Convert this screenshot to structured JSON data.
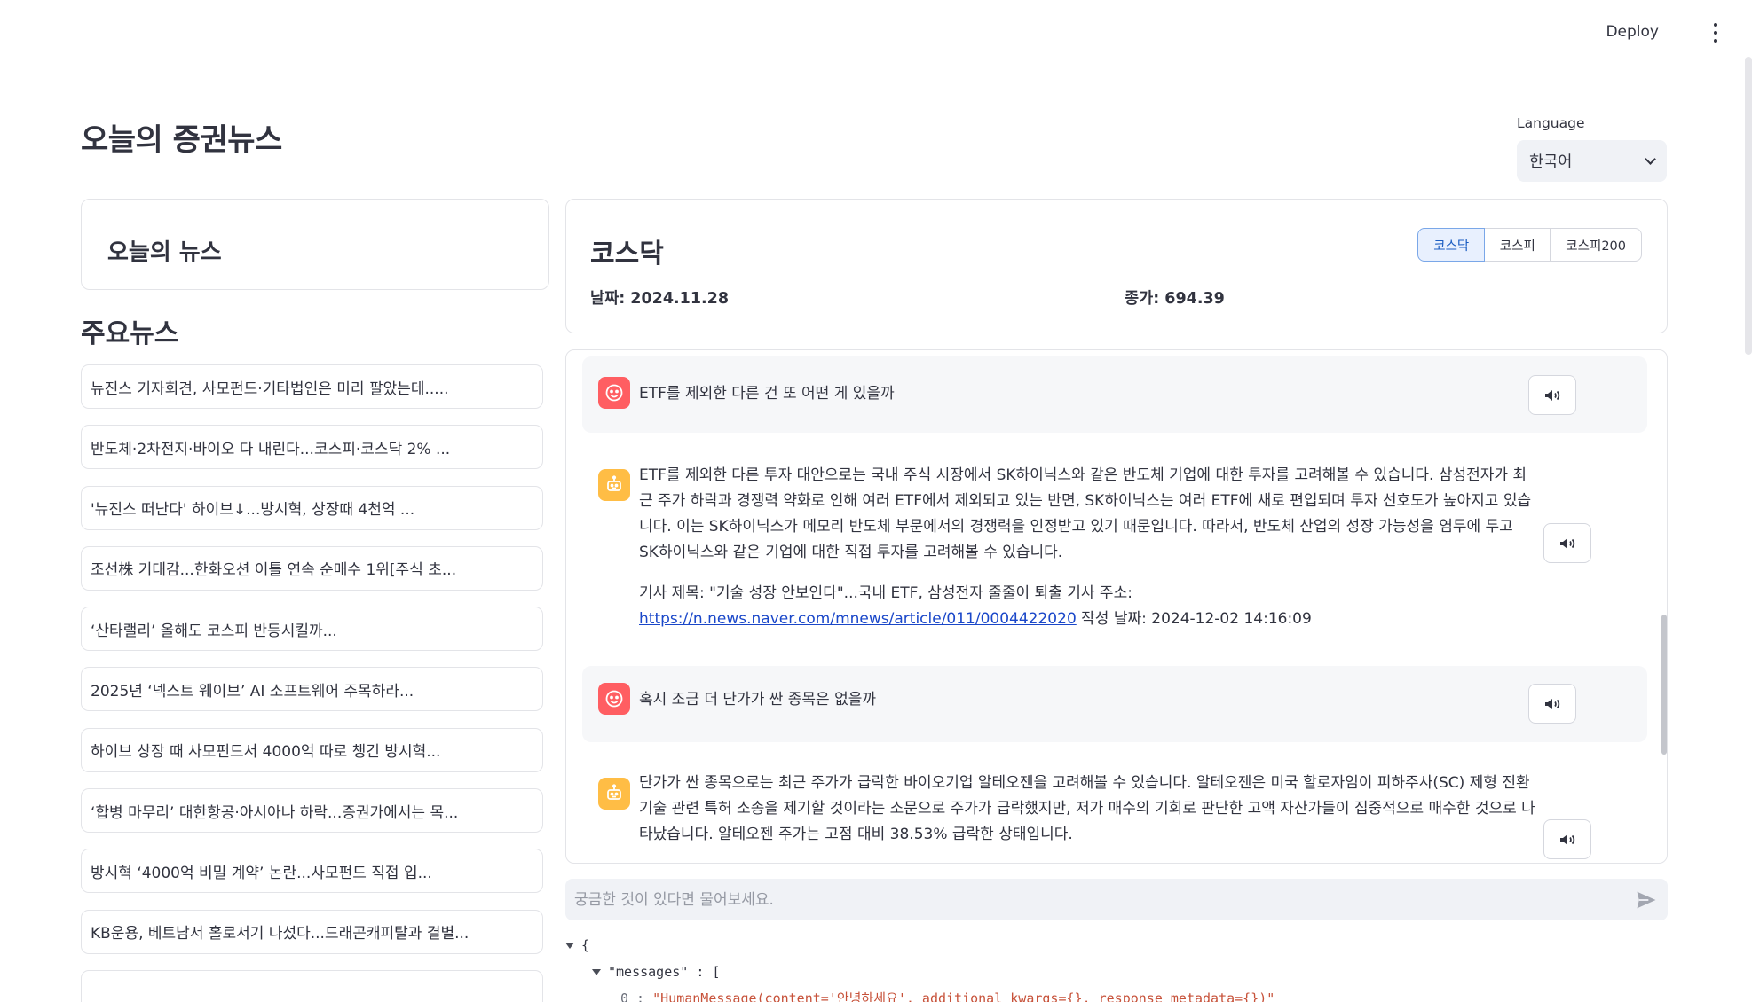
{
  "header": {
    "deploy_label": "Deploy",
    "menu_icon": "kebab-menu-icon"
  },
  "app": {
    "title": "오늘의 증권뉴스"
  },
  "language": {
    "label": "Language",
    "selected": "한국어"
  },
  "news_card": {
    "title": "오늘의 뉴스"
  },
  "headlines": {
    "title": "주요뉴스",
    "items": [
      "뉴진스 기자회견, 사모펀드·기타법인은 미리 팔았는데.....",
      "반도체·2차전지·바이오 다 내린다...코스피·코스닥 2% ...",
      "'뉴진스 떠난다' 하이브↓...방시혁, 상장때 4천억 ...",
      "조선株 기대감...한화오션 이틀 연속 순매수 1위[주식 초...",
      "‘산타랠리’ 올해도 코스피 반등시킬까...",
      "2025년 ‘넥스트 웨이브’ AI 소프트웨어 주목하라...",
      "하이브 상장 때 사모펀드서 4000억 따로 챙긴 방시혁...",
      "‘합병 마무리’ 대한항공·아시아나 하락...증권가에서는 목...",
      "방시혁 ‘4000억 비밀 계약’ 논란...사모펀드 직접 입...",
      "KB운용, 베트남서 홀로서기 나섰다...드래곤캐피탈과 결별...",
      ""
    ]
  },
  "market": {
    "title": "코스닥",
    "tabs": [
      "코스닥",
      "코스피",
      "코스피200"
    ],
    "active_tab": "코스닥",
    "date_text": "날짜: 2024.11.28",
    "close_text": "종가: 694.39"
  },
  "chat": {
    "messages": [
      {
        "role": "user",
        "text": "ETF를 제외한 다른 건 또 어떤 게 있을까"
      },
      {
        "role": "assistant",
        "text": "ETF를 제외한 다른 투자 대안으로는 국내 주식 시장에서 SK하이닉스와 같은 반도체 기업에 대한 투자를 고려해볼 수 있습니다. 삼성전자가 최근 주가 하락과 경쟁력 약화로 인해 여러 ETF에서 제외되고 있는 반면, SK하이닉스는 여러 ETF에 새로 편입되며 투자 선호도가 높아지고 있습니다. 이는 SK하이닉스가 메모리 반도체 부문에서의 경쟁력을 인정받고 있기 때문입니다. 따라서, 반도체 산업의 성장 가능성을 염두에 두고 SK하이닉스와 같은 기업에 대한 직접 투자를 고려해볼 수 있습니다.",
        "source_prefix": "기사 제목: \"기술 성장 안보인다\"...국내 ETF, 삼성전자 줄줄이 퇴출 기사 주소:",
        "source_url": "https://n.news.naver.com/mnews/article/011/0004422020",
        "source_suffix": " 작성 날짜: 2024-12-02 14:16:09"
      },
      {
        "role": "user",
        "text": "혹시 조금 더 단가가 싼 종목은 없을까"
      },
      {
        "role": "assistant",
        "text": "단가가 싼 종목으로는 최근 주가가 급락한 바이오기업 알테오젠을 고려해볼 수 있습니다. 알테오젠은 미국 할로자임이 피하주사(SC) 제형 전환 기술 관련 특허 소송을 제기할 것이라는 소문으로 주가가 급락했지만, 저가 매수의 기회로 판단한 고액 자산가들이 집중적으로 매수한 것으로 나타났습니다. 알테오젠 주가는 고점 대비 38.53% 급락한 상태입니다."
      }
    ],
    "input_placeholder": "궁금한 것이 있다면 물어보세요.",
    "input_value": ""
  },
  "json_view": {
    "open_brace": "{",
    "messages_key": "\"messages\"",
    "colon_bracket": " : [",
    "row0_index": "0",
    "row0_value": "\"HumanMessage(content='안녕하세요', additional_kwargs={}, response_metadata={})\""
  },
  "colors": {
    "user_avatar": "#ff5e62",
    "bot_avatar": "#ffbd45",
    "link": "#1a47c9",
    "active_tab_bg": "#e8f0fe",
    "active_tab_text": "#1a5dc2"
  }
}
